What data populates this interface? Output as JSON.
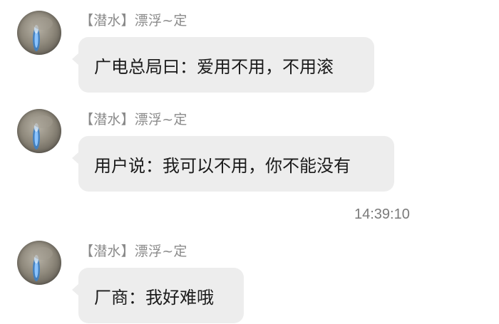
{
  "messages": [
    {
      "avatar_icon": "avatar-image",
      "sender": "【潜水】漂浮~定",
      "text": "广电总局曰：爱用不用，不用滚"
    },
    {
      "avatar_icon": "avatar-image",
      "sender": "【潜水】漂浮~定",
      "text": "用户说：我可以不用，你不能没有"
    },
    {
      "avatar_icon": "avatar-image",
      "sender": "【潜水】漂浮~定",
      "text": "厂商：我好难哦"
    }
  ],
  "timestamp": "14:39:10",
  "colors": {
    "bubble": "#ededed",
    "sender_text": "#8a8a8a",
    "message_text": "#1a1a1a",
    "timestamp_text": "#7a7a7a"
  }
}
